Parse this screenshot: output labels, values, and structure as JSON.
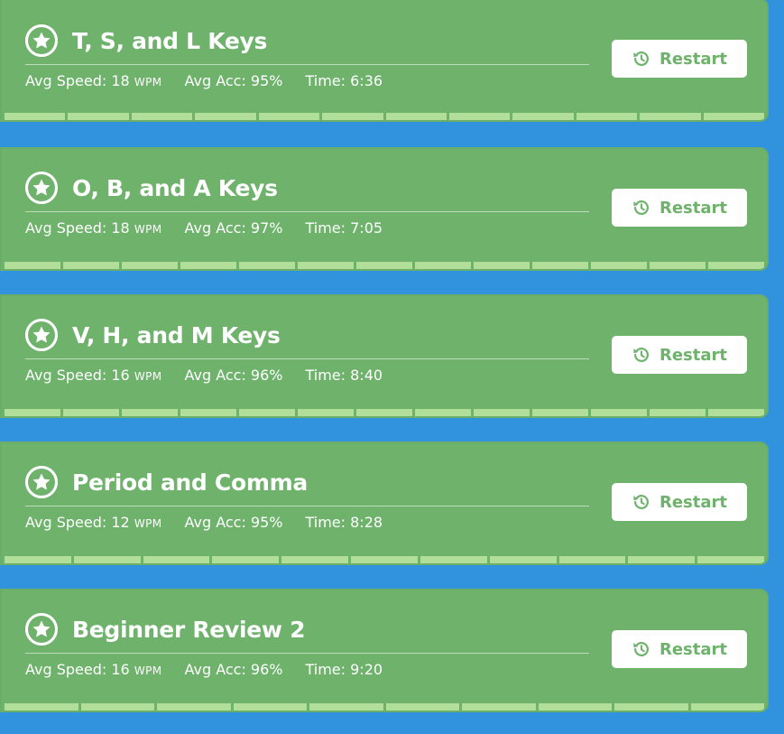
{
  "colors": {
    "background": "#3193de",
    "card": "#6eb26c",
    "progress": "#b1de98",
    "button_text": "#6eb26c"
  },
  "icons": {
    "badge": "star-icon",
    "restart": "history-icon"
  },
  "lessons": [
    {
      "title": "T, S, and L Keys",
      "speed_label": "Avg Speed: 18",
      "speed_unit": "WPM",
      "accuracy": "Avg Acc: 95%",
      "time": "Time: 6:36",
      "button_label": "Restart",
      "segments": 12
    },
    {
      "title": "O, B, and A Keys",
      "speed_label": "Avg Speed: 18",
      "speed_unit": "WPM",
      "accuracy": "Avg Acc: 97%",
      "time": "Time: 7:05",
      "button_label": "Restart",
      "segments": 13
    },
    {
      "title": "V, H, and M Keys",
      "speed_label": "Avg Speed: 16",
      "speed_unit": "WPM",
      "accuracy": "Avg Acc: 96%",
      "time": "Time: 8:40",
      "button_label": "Restart",
      "segments": 13
    },
    {
      "title": "Period and Comma",
      "speed_label": "Avg Speed: 12",
      "speed_unit": "WPM",
      "accuracy": "Avg Acc: 95%",
      "time": "Time: 8:28",
      "button_label": "Restart",
      "segments": 11
    },
    {
      "title": "Beginner Review 2",
      "speed_label": "Avg Speed: 16",
      "speed_unit": "WPM",
      "accuracy": "Avg Acc: 96%",
      "time": "Time: 9:20",
      "button_label": "Restart",
      "segments": 10
    }
  ]
}
